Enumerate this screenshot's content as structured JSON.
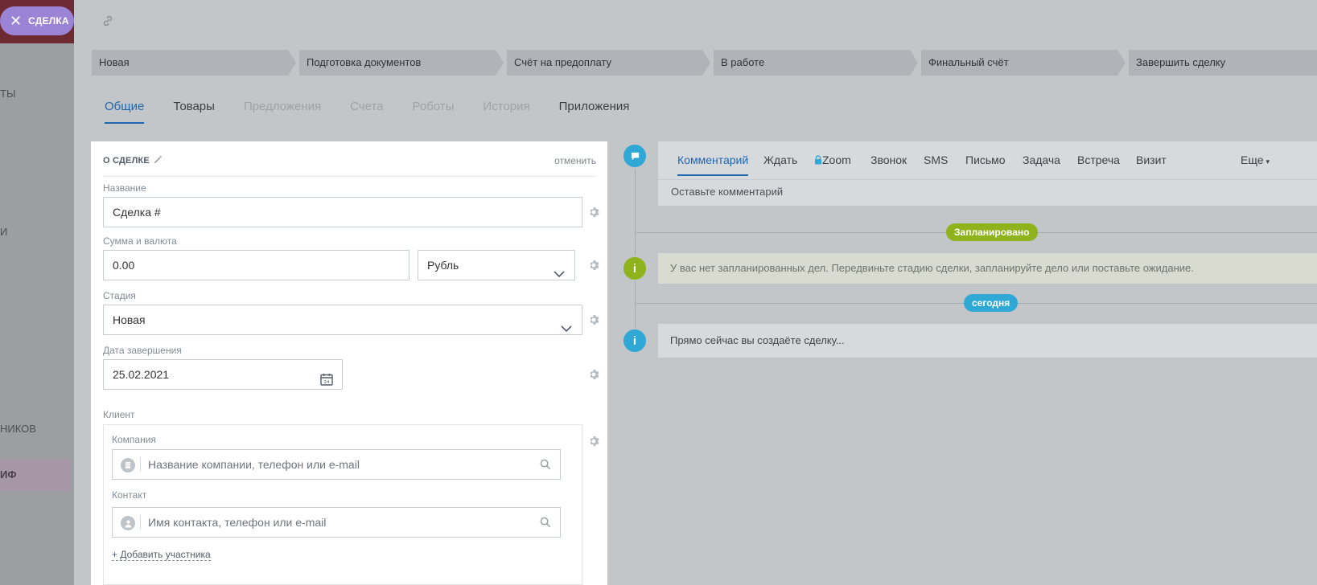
{
  "close_button": {
    "label": "СДЕЛКА"
  },
  "background_nav": {
    "items": [
      {
        "label": "ТЫ"
      },
      {
        "label": "И"
      },
      {
        "label": "НИКОВ"
      },
      {
        "label": "ИФ"
      }
    ]
  },
  "stages": [
    {
      "label": "Новая"
    },
    {
      "label": "Подготовка документов"
    },
    {
      "label": "Счёт на предоплату"
    },
    {
      "label": "В работе"
    },
    {
      "label": "Финальный счёт"
    },
    {
      "label": "Завершить сделку"
    }
  ],
  "tabs": [
    {
      "label": "Общие",
      "state": "active"
    },
    {
      "label": "Товары",
      "state": "enabled"
    },
    {
      "label": "Предложения",
      "state": "disabled"
    },
    {
      "label": "Счета",
      "state": "disabled"
    },
    {
      "label": "Роботы",
      "state": "disabled"
    },
    {
      "label": "История",
      "state": "disabled"
    },
    {
      "label": "Приложения",
      "state": "enabled"
    }
  ],
  "form": {
    "section_title": "О СДЕЛКЕ",
    "cancel_label": "отменить",
    "name_label": "Название",
    "name_value": "Сделка #",
    "sum_label": "Сумма и валюта",
    "sum_value": "0.00",
    "currency_value": "Рубль",
    "stage_label": "Стадия",
    "stage_value": "Новая",
    "date_label": "Дата завершения",
    "date_value": "25.02.2021",
    "client_label": "Клиент",
    "company_label": "Компания",
    "company_placeholder": "Название компании, телефон или e-mail",
    "contact_label": "Контакт",
    "contact_placeholder": "Имя контакта, телефон или e-mail",
    "add_participant": "+ Добавить участника"
  },
  "timeline": {
    "tabs": [
      {
        "label": "Комментарий",
        "active": true
      },
      {
        "label": "Ждать"
      },
      {
        "label": "Zoom",
        "locked": true
      },
      {
        "label": "Звонок"
      },
      {
        "label": "SMS"
      },
      {
        "label": "Письмо"
      },
      {
        "label": "Задача"
      },
      {
        "label": "Встреча"
      },
      {
        "label": "Визит"
      }
    ],
    "more_label": "Еще",
    "comment_placeholder": "Оставьте комментарий",
    "planned_badge": "Запланировано",
    "planned_text": "У вас нет запланированных дел. Передвиньте стадию сделки, запланируйте дело или поставьте ожидание.",
    "today_badge": "сегодня",
    "today_text": "Прямо сейчас вы создаёте сделку..."
  },
  "colors": {
    "accent": "#2067b0",
    "planned_green": "#8fb31d",
    "today_blue": "#2fa8d6",
    "close_purple": "#9b84d6"
  }
}
